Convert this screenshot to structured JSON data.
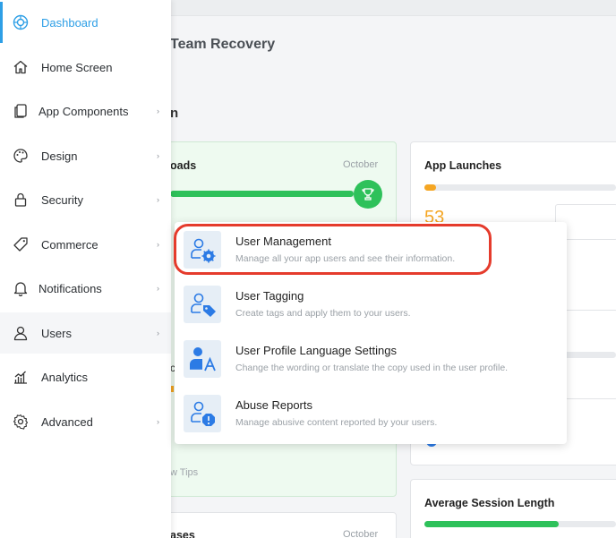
{
  "page": {
    "title": "Team Recovery",
    "subtitle": "n"
  },
  "cards": {
    "downloads": {
      "title": "oads",
      "month": "October",
      "progress": 0.93,
      "faint_label": "w Tips",
      "partial_char": "c"
    },
    "launches": {
      "title": "App Launches",
      "count": "53",
      "progress": 0.06
    },
    "sessions": {
      "title": "Average Session Length",
      "progress": 0.7
    },
    "releases": {
      "title": "ases",
      "month": "October"
    }
  },
  "sidebar": {
    "items": [
      {
        "label": "Dashboard",
        "icon": "dashboard-icon"
      },
      {
        "label": "Home Screen",
        "icon": "home-icon"
      },
      {
        "label": "App Components",
        "icon": "components-icon"
      },
      {
        "label": "Design",
        "icon": "palette-icon"
      },
      {
        "label": "Security",
        "icon": "lock-icon"
      },
      {
        "label": "Commerce",
        "icon": "tag-icon"
      },
      {
        "label": "Notifications",
        "icon": "bell-icon"
      },
      {
        "label": "Users",
        "icon": "user-icon"
      },
      {
        "label": "Analytics",
        "icon": "chart-icon"
      },
      {
        "label": "Advanced",
        "icon": "gear-icon"
      }
    ],
    "chevron": "›"
  },
  "users_menu": {
    "items": [
      {
        "title": "User Management",
        "description": "Manage all your app users and see their information.",
        "icon": "user-settings-icon"
      },
      {
        "title": "User Tagging",
        "description": "Create tags and apply them to your users.",
        "icon": "user-tag-icon"
      },
      {
        "title": "User Profile Language Settings",
        "description": "Change the wording or translate the copy used in the user profile.",
        "icon": "user-language-icon"
      },
      {
        "title": "Abuse Reports",
        "description": "Manage abusive content reported by your users.",
        "icon": "user-report-icon"
      }
    ]
  },
  "colors": {
    "accent": "#2e9fe6",
    "success": "#2ec15a",
    "warning": "#f5a623",
    "highlight": "#e53b2c",
    "icon_blue": "#2c7be5"
  }
}
